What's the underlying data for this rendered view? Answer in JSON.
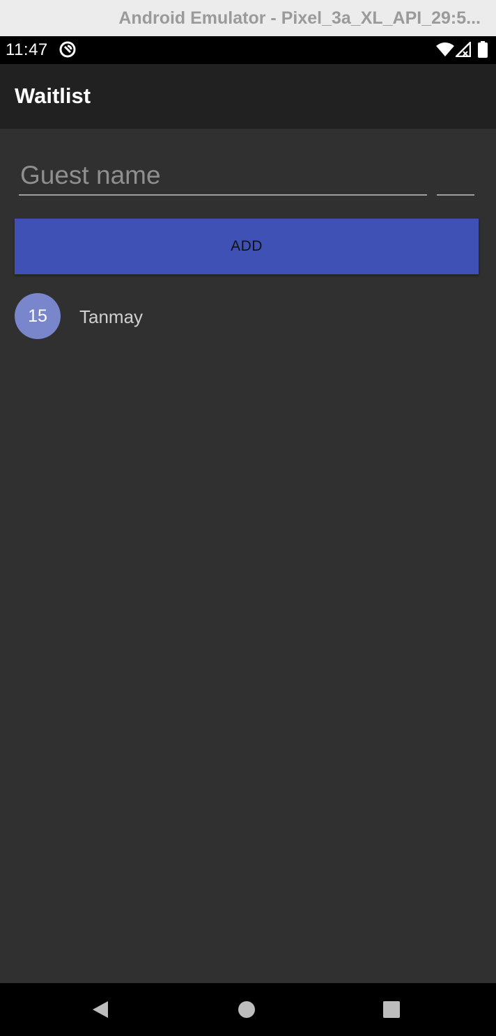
{
  "window": {
    "title": "Android Emulator - Pixel_3a_XL_API_29:5..."
  },
  "status_bar": {
    "time": "11:47",
    "icons": [
      "notification-icon",
      "wifi-icon",
      "cellular-signal-icon",
      "battery-icon"
    ]
  },
  "app_bar": {
    "title": "Waitlist"
  },
  "form": {
    "name_placeholder": "Guest name",
    "name_value": "",
    "party_size_value": "",
    "add_label": "ADD"
  },
  "guests": [
    {
      "party_size": "15",
      "name": "Tanmay"
    }
  ],
  "nav_bar": {
    "icons": [
      "back-icon",
      "home-icon",
      "recents-icon"
    ]
  },
  "colors": {
    "primary": "#3f51b5",
    "badge": "#7986cb",
    "background": "#303030",
    "app_bar": "#212121"
  }
}
